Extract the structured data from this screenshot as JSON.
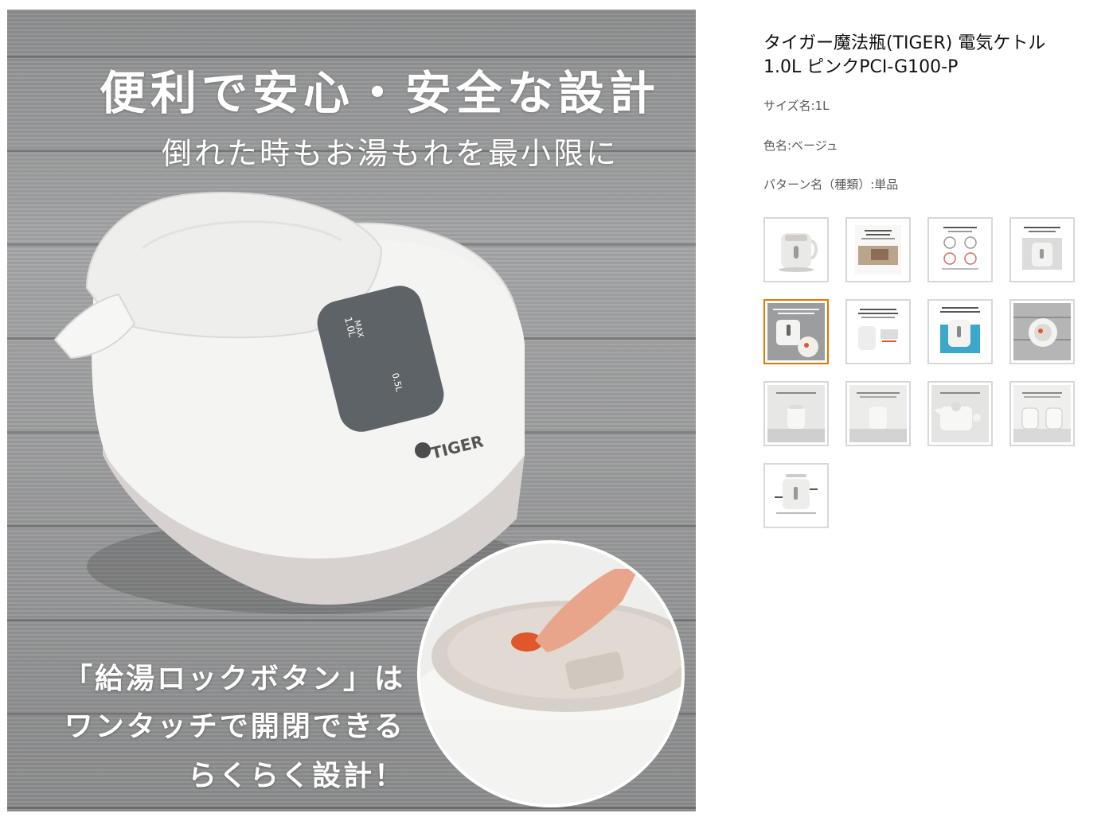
{
  "main_image": {
    "headline": "便利で安心・安全な設計",
    "subline": "倒れた時もお湯もれを最小限に",
    "kettle_level_max": "1.0L",
    "kettle_level_max_sub": "MAX",
    "kettle_level_half": "0.5L",
    "kettle_brand": "TIGER",
    "caption_lines": [
      "「給湯ロックボタン」は",
      "ワンタッチで開閉できる",
      "らくらく設計！"
    ]
  },
  "product": {
    "title": "タイガー魔法瓶(TIGER) 電気ケトル 1.0L ピンクPCI-G100-P",
    "size": "サイズ名:1L",
    "color": "色名:ベージュ",
    "pattern": "パターン名（種類）:単品"
  },
  "thumbnails": [
    {
      "name": "thumb-kettle-photo",
      "selected": false
    },
    {
      "name": "thumb-photo-card",
      "selected": false
    },
    {
      "name": "thumb-safety-diagram",
      "selected": false
    },
    {
      "name": "thumb-kettle-detail",
      "selected": false
    },
    {
      "name": "thumb-lock-button",
      "selected": true
    },
    {
      "name": "thumb-features",
      "selected": false
    },
    {
      "name": "thumb-kettle-blue",
      "selected": false
    },
    {
      "name": "thumb-kettle-top",
      "selected": false
    },
    {
      "name": "thumb-kettle-table",
      "selected": false
    },
    {
      "name": "thumb-kettle-side",
      "selected": false
    },
    {
      "name": "thumb-kettle-parts",
      "selected": false
    },
    {
      "name": "thumb-kettle-pair",
      "selected": false
    },
    {
      "name": "thumb-kettle-specs",
      "selected": false
    }
  ],
  "colors": {
    "selected_border": "#e77600",
    "thumb_border": "#d5d9d9",
    "title_text": "#0f1111",
    "attr_text": "#565959"
  }
}
